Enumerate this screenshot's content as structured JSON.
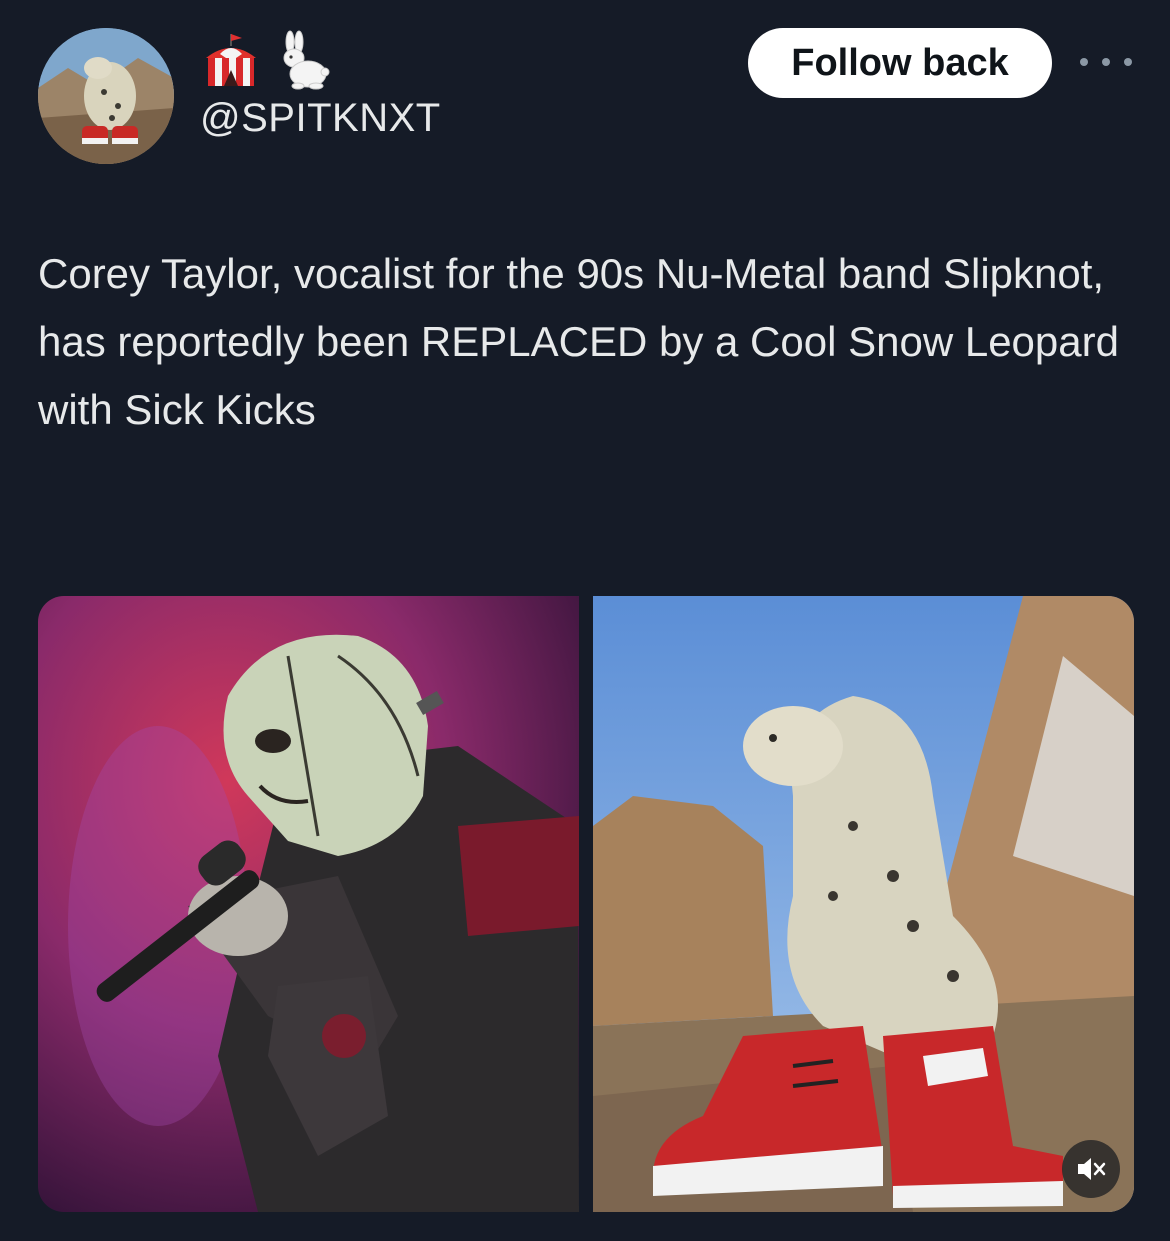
{
  "post": {
    "author": {
      "emoji_icons": [
        "circus-tent-icon",
        "rabbit-icon"
      ],
      "handle": "@SPITKNXT"
    },
    "follow_button_label": "Follow back",
    "more_icon": "ellipsis-icon",
    "text": "Corey Taylor, vocalist for the 90s Nu-Metal band Slipknot, has reportedly been REPLACED by a Cool Snow Leopard with Sick Kicks",
    "media": [
      {
        "kind": "photo"
      },
      {
        "kind": "video",
        "mute_icon": "speaker-muted-icon"
      }
    ]
  },
  "colors": {
    "background": "#151b27",
    "text": "#e7e9ea",
    "button_bg": "#ffffff",
    "button_text": "#0f1419",
    "muted_icon": "#8b98a5"
  }
}
